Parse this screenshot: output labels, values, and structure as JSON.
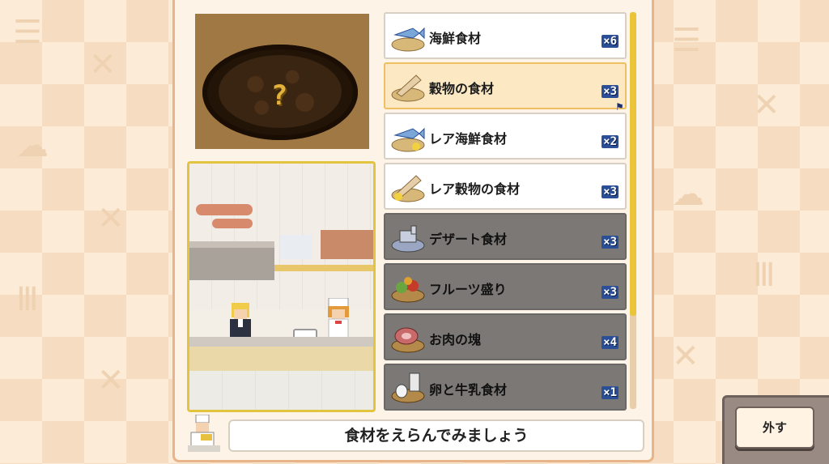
{
  "dish_preview": {
    "unknown_mark": "?"
  },
  "ingredients": [
    {
      "name": "海鮮食材",
      "count": "×6",
      "icon": "fish-icon",
      "state": "normal"
    },
    {
      "name": "穀物の食材",
      "count": "×3",
      "icon": "grain-bundle-icon",
      "state": "selected"
    },
    {
      "name": "レア海鮮食材",
      "count": "×2",
      "icon": "rare-fish-icon",
      "state": "normal"
    },
    {
      "name": "レア穀物の食材",
      "count": "×3",
      "icon": "rare-grain-icon",
      "state": "normal"
    },
    {
      "name": "デザート食材",
      "count": "×3",
      "icon": "dessert-icon",
      "state": "dim"
    },
    {
      "name": "フルーツ盛り",
      "count": "×3",
      "icon": "fruit-basket-icon",
      "state": "dim"
    },
    {
      "name": "お肉の塊",
      "count": "×4",
      "icon": "meat-icon",
      "state": "dim"
    },
    {
      "name": "卵と牛乳食材",
      "count": "×1",
      "icon": "egg-milk-icon",
      "state": "dim"
    }
  ],
  "message": "食材をえらんでみましょう",
  "remove_button": "外す",
  "colors": {
    "panel_border": "#e8b48a",
    "selected_item": "#fde8c4",
    "dim_item": "#7b7875",
    "count_badge": "#2a4f96",
    "kitchen_frame": "#e3c43e"
  }
}
